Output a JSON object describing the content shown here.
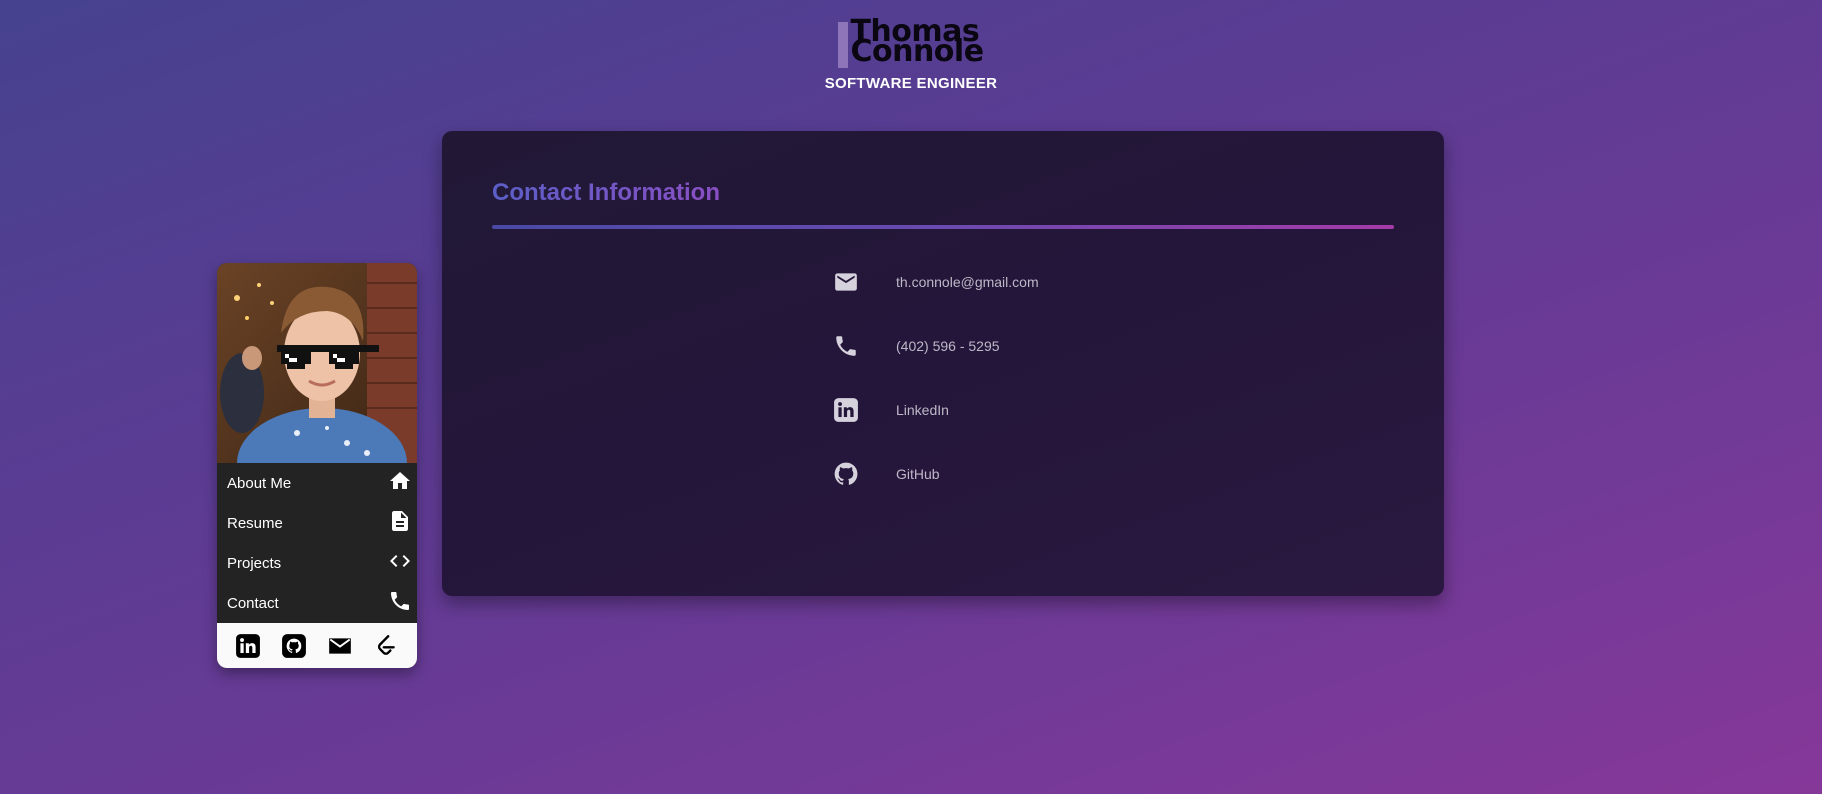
{
  "header": {
    "name_line1": "Thomas",
    "name_line2": "Connole",
    "subtitle": "SOFTWARE ENGINEER"
  },
  "sidebar": {
    "nav": [
      {
        "label": "About Me",
        "icon": "home-icon"
      },
      {
        "label": "Resume",
        "icon": "document-icon"
      },
      {
        "label": "Projects",
        "icon": "code-icon"
      },
      {
        "label": "Contact",
        "icon": "phone-icon"
      }
    ],
    "social": [
      "linkedin-icon",
      "github-icon",
      "email-icon",
      "leetcode-icon"
    ]
  },
  "contact": {
    "title": "Contact Information",
    "items": [
      {
        "icon": "email-icon",
        "text": "th.connole@gmail.com"
      },
      {
        "icon": "phone-icon",
        "text": "(402) 596 - 5295"
      },
      {
        "icon": "linkedin-icon",
        "text": "LinkedIn"
      },
      {
        "icon": "github-icon",
        "text": "GitHub"
      }
    ]
  },
  "colors": {
    "accent_start": "#4a4aa6",
    "accent_end": "#a43ba8",
    "panel_bg": "#24163a",
    "nav_bg": "#232323"
  }
}
